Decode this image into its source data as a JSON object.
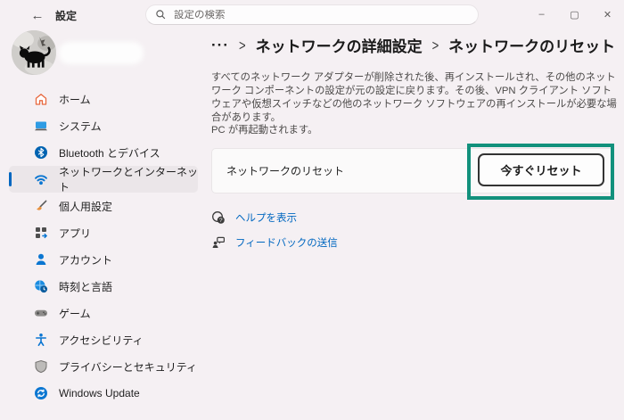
{
  "window": {
    "app_title": "設定",
    "back_glyph": "←",
    "controls": {
      "minimize": "–",
      "maximize": "▢",
      "close": "✕"
    }
  },
  "search": {
    "placeholder": "設定の検索"
  },
  "sidebar": {
    "items": [
      {
        "label": "ホーム",
        "icon": "home-icon",
        "selected": false
      },
      {
        "label": "システム",
        "icon": "system-icon",
        "selected": false
      },
      {
        "label": "Bluetooth とデバイス",
        "icon": "bluetooth-icon",
        "selected": false
      },
      {
        "label": "ネットワークとインターネット",
        "icon": "network-icon",
        "selected": true
      },
      {
        "label": "個人用設定",
        "icon": "personalization-icon",
        "selected": false
      },
      {
        "label": "アプリ",
        "icon": "apps-icon",
        "selected": false
      },
      {
        "label": "アカウント",
        "icon": "accounts-icon",
        "selected": false
      },
      {
        "label": "時刻と言語",
        "icon": "time-language-icon",
        "selected": false
      },
      {
        "label": "ゲーム",
        "icon": "gaming-icon",
        "selected": false
      },
      {
        "label": "アクセシビリティ",
        "icon": "accessibility-icon",
        "selected": false
      },
      {
        "label": "プライバシーとセキュリティ",
        "icon": "privacy-icon",
        "selected": false
      },
      {
        "label": "Windows Update",
        "icon": "windows-update-icon",
        "selected": false
      }
    ]
  },
  "breadcrumb": {
    "ellipsis": "···",
    "separator": ">",
    "items": [
      "ネットワークの詳細設定",
      "ネットワークのリセット"
    ]
  },
  "main": {
    "description": "すべてのネットワーク アダプターが削除された後、再インストールされ、その他のネットワーク コンポーネントの設定が元の設定に戻ります。その後、VPN クライアント ソフトウェアや仮想スイッチなどの他のネットワーク ソフトウェアの再インストールが必要な場合があります。",
    "restart_note": "PC が再起動されます。",
    "reset_card": {
      "label": "ネットワークのリセット",
      "button_label": "今すぐリセット"
    },
    "links": [
      {
        "label": "ヘルプを表示",
        "icon": "help-icon"
      },
      {
        "label": "フィードバックの送信",
        "icon": "feedback-icon"
      }
    ]
  },
  "colors": {
    "accent_blue": "#0067c0",
    "link_blue": "#0067c0",
    "annotation_green": "#12917c",
    "background": "#f5f0f3"
  }
}
